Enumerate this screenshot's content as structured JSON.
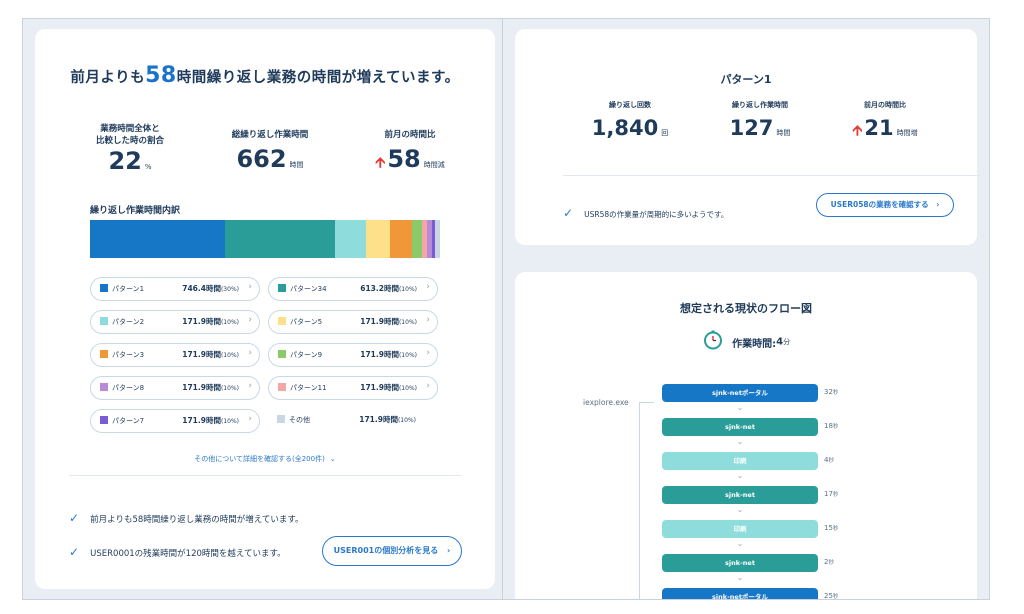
{
  "left": {
    "headline": {
      "prefix": "前月よりも",
      "number": "58",
      "suffix": "時間繰り返し業務の時間が増えています。"
    },
    "stats": [
      {
        "label_line1": "業務時間全体と",
        "label_line2": "比較した時の割合",
        "value": "22",
        "unit": "%"
      },
      {
        "label": "総繰り返し作業時間",
        "value": "662",
        "unit": "時間"
      },
      {
        "label": "前月の時間比",
        "value": "58",
        "unit": "時間減"
      }
    ],
    "breakdown_title": "繰り返し作業時間内訳",
    "bar_segments": [
      {
        "color": "#1677c7",
        "share": 0.385
      },
      {
        "color": "#2a9d99",
        "share": 0.315
      },
      {
        "color": "#8fdcdc",
        "share": 0.088
      },
      {
        "color": "#ffe08a",
        "share": 0.07
      },
      {
        "color": "#f0973a",
        "share": 0.062
      },
      {
        "color": "#8bc96a",
        "share": 0.028
      },
      {
        "color": "#f4a6a6",
        "share": 0.016
      },
      {
        "color": "#b98ad6",
        "share": 0.012
      },
      {
        "color": "#7b5bd6",
        "share": 0.01
      },
      {
        "color": "#c9d6e3",
        "share": 0.014
      }
    ],
    "legend": [
      {
        "name": "パターン1",
        "value": "746.4時間",
        "pct": "(30%)",
        "color": "#1677c7"
      },
      {
        "name": "パターン34",
        "value": "613.2時間",
        "pct": "(10%)",
        "color": "#2a9d99"
      },
      {
        "name": "パターン2",
        "value": "171.9時間",
        "pct": "(10%)",
        "color": "#8fdcdc"
      },
      {
        "name": "パターン5",
        "value": "171.9時間",
        "pct": "(10%)",
        "color": "#ffe08a"
      },
      {
        "name": "パターン3",
        "value": "171.9時間",
        "pct": "(10%)",
        "color": "#f0973a"
      },
      {
        "name": "パターン9",
        "value": "171.9時間",
        "pct": "(10%)",
        "color": "#8bc96a"
      },
      {
        "name": "パターン8",
        "value": "171.9時間",
        "pct": "(10%)",
        "color": "#b98ad6"
      },
      {
        "name": "パターン11",
        "value": "171.9時間",
        "pct": "(10%)",
        "color": "#f4a6a6"
      },
      {
        "name": "パターン7",
        "value": "171.9時間",
        "pct": "(10%)",
        "color": "#7b5bd6"
      },
      {
        "name": "その他",
        "value": "171.9時間",
        "pct": "(10%)",
        "color": "#c9d6e3"
      }
    ],
    "more_link": "その他について詳細を確認する(全200件)",
    "notes": [
      "前月よりも58時間繰り返し業務の時間が増えています。",
      "USER0001の残業時間が120時間を越えています。"
    ],
    "individual_button": "USER001の個別分析を見る"
  },
  "pattern": {
    "title": "パターン1",
    "stats": [
      {
        "label": "繰り返し回数",
        "value": "1,840",
        "unit": "回"
      },
      {
        "label": "繰り返し作業時間",
        "value": "127",
        "unit": "時間"
      },
      {
        "label": "前月の時間比",
        "value": "21",
        "unit": "時間増"
      }
    ],
    "note": "USR58の作業量が周期的に多いようです。",
    "confirm_button": "USER058の業務を確認する"
  },
  "flow": {
    "title": "想定される現状のフロー図",
    "work_time_label": "作業時間:",
    "work_time_value": "4",
    "work_time_unit": "分",
    "app_label": "iexplore.exe",
    "nodes": [
      {
        "label": "sjnk-netポータル",
        "time": "32",
        "unit": "秒",
        "color": "#1677c7"
      },
      {
        "label": "sjnk-net",
        "time": "18",
        "unit": "秒",
        "color": "#2a9d99"
      },
      {
        "label": "印刷",
        "time": "4",
        "unit": "秒",
        "color": "#8fdcdc"
      },
      {
        "label": "sjnk-net",
        "time": "17",
        "unit": "秒",
        "color": "#2a9d99"
      },
      {
        "label": "印刷",
        "time": "15",
        "unit": "秒",
        "color": "#8fdcdc"
      },
      {
        "label": "sjnk-net",
        "time": "2",
        "unit": "秒",
        "color": "#2a9d99"
      },
      {
        "label": "sjnk-netポータル",
        "time": "25",
        "unit": "秒",
        "color": "#1677c7"
      }
    ]
  }
}
